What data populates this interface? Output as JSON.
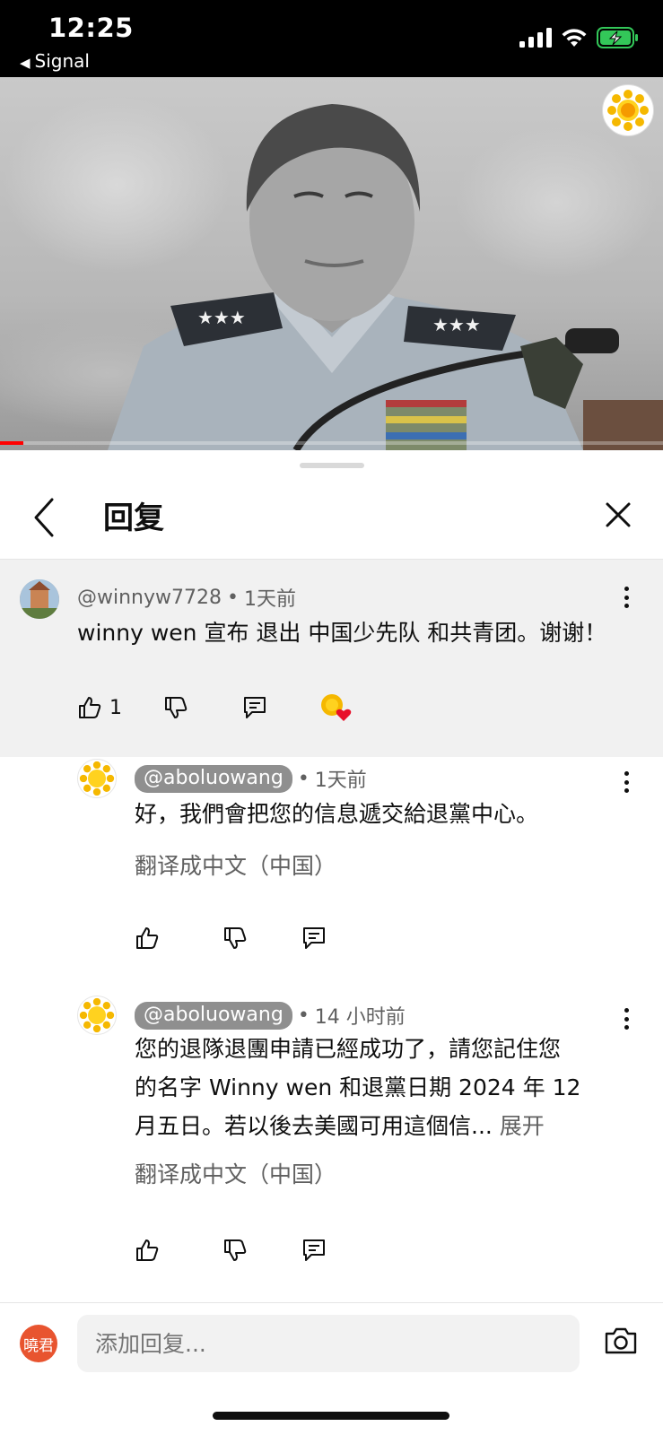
{
  "status_bar": {
    "time": "12:25",
    "back_app": "Signal",
    "icons": [
      "signal-bars-icon",
      "wifi-icon",
      "battery-charging-icon"
    ],
    "battery_color": "#33c759"
  },
  "video": {
    "progress_fraction": 0.035,
    "progress_color": "#ff0000",
    "channel_logo": "sunflower-logo"
  },
  "sheet": {
    "title": "回复",
    "back_icon": "chevron-left-icon",
    "close_icon": "close-icon"
  },
  "parent_comment": {
    "handle": "@winnyw7728",
    "separator": "•",
    "time": "1天前",
    "text": "winny wen  宣布 退出 中国少先队 和共青团。谢谢！",
    "like_count": "1",
    "creator_heart": true
  },
  "replies": [
    {
      "handle": "@aboluowang",
      "separator": "•",
      "time": "1天前",
      "text": "好，我們會把您的信息遞交給退黨中心。",
      "translate": "翻译成中文（中国）"
    },
    {
      "handle": "@aboluowang",
      "separator": "•",
      "time": "14 小时前",
      "text_line1": "您的退隊退團申請已經成功了，請您記住您",
      "text_line2": "的名字 Winny wen 和退黨日期 2024 年 12",
      "text_line3": "月五日。若以後去美國可用這個信...",
      "expand": "展开",
      "translate": "翻译成中文（中国）"
    }
  ],
  "composer": {
    "avatar_text": "曉君",
    "avatar_color": "#e8542f",
    "placeholder": "添加回复...",
    "camera_icon": "camera-icon"
  }
}
